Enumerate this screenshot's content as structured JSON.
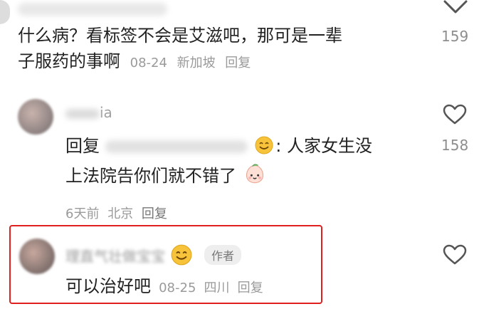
{
  "top_comment": {
    "text_line1": "什么病？看标签不会是艾滋吧，那可是一辈",
    "text_line2": "子服药的事啊",
    "date": "08-24",
    "location": "新加坡",
    "reply_label": "回复",
    "like_count": "159"
  },
  "reply1": {
    "username_visible": "ia",
    "prefix": "回复",
    "text_line1_after": "人家女生没",
    "text_line2": "上法院告你们就不错了",
    "time": "6天前",
    "location": "北京",
    "reply_label": "回复",
    "like_count": "158"
  },
  "reply2": {
    "username": "理直气壮做宝宝",
    "author_badge": "作者",
    "text": "可以治好吧",
    "date": "08-25",
    "location": "四川",
    "reply_label": "回复"
  },
  "colors": {
    "highlight": "#e02020",
    "emoji_yellow": "#f7c33b",
    "heart_stroke": "#555555"
  }
}
